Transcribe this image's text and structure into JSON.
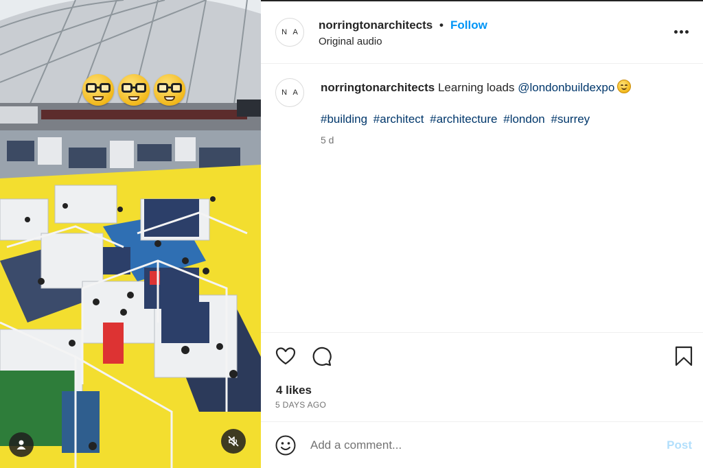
{
  "media": {
    "emoji_count": 3,
    "emoji_icon": "nerd-face-emoji"
  },
  "header": {
    "avatar_initials": "N A",
    "username": "norringtonarchitects",
    "separator": "•",
    "follow_label": "Follow",
    "audio_label": "Original audio"
  },
  "caption": {
    "avatar_initials": "N A",
    "username": "norringtonarchitects",
    "text": " Learning loads ",
    "mention": "@londonbuildexpo",
    "hashtags": [
      "#building",
      "#architect",
      "#architecture",
      "#london",
      "#surrey"
    ],
    "time": "5 d"
  },
  "actions": {
    "likes": "4 likes",
    "date": "5 DAYS AGO"
  },
  "comment": {
    "placeholder": "Add a comment...",
    "post_label": "Post"
  },
  "colors": {
    "link_blue": "#0095f6",
    "hashtag_blue": "#00376b",
    "muted_gray": "#737373",
    "floor_yellow": "#f3de2f"
  }
}
